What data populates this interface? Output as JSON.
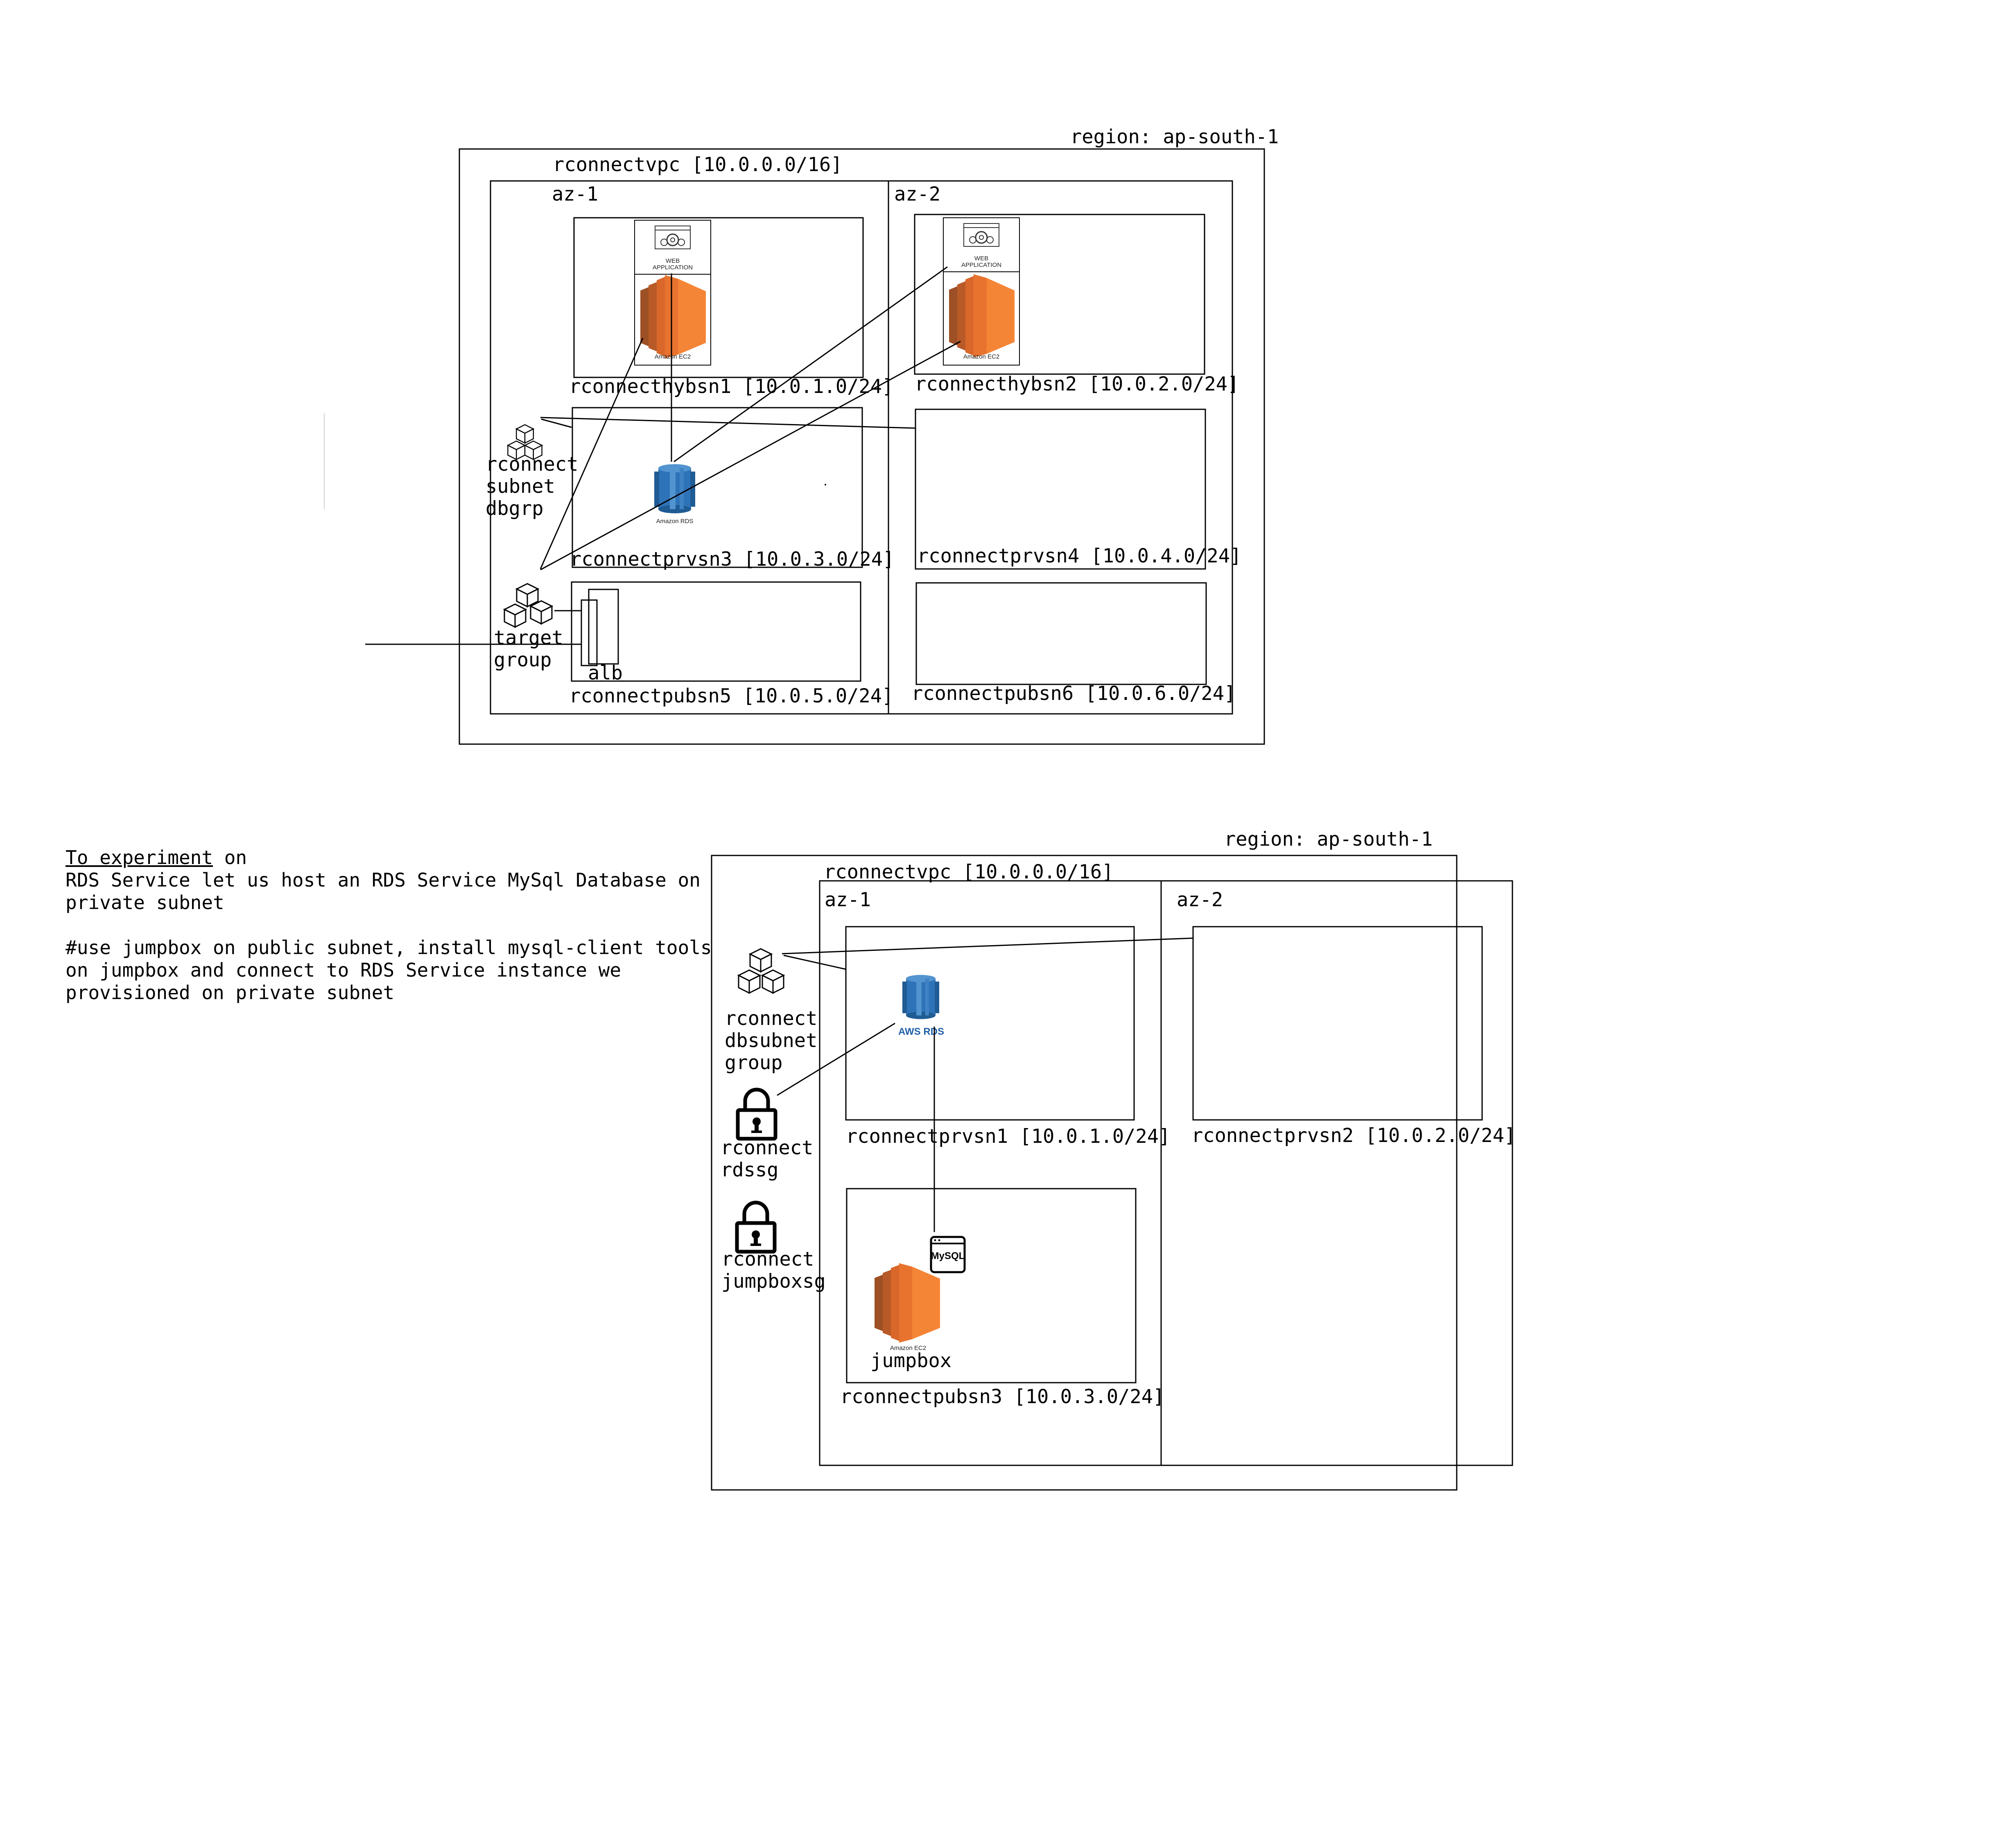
{
  "diagram1": {
    "region": "region: ap-south-1",
    "vpc": "rconnectvpc [10.0.0.0/16]",
    "az1": "az-1",
    "az2": "az-2",
    "subnets": {
      "hybsn1": "rconnecthybsn1 [10.0.1.0/24]",
      "hybsn2": "rconnecthybsn2 [10.0.2.0/24]",
      "prvsn3": "rconnectprvsn3 [10.0.3.0/24]",
      "prvsn4": "rconnectprvsn4 [10.0.4.0/24]",
      "pubsn5": "rconnectpubsn5 [10.0.5.0/24]",
      "pubsn6": "rconnectpubsn6 [10.0.6.0/24]"
    },
    "dbgrp": [
      "rconnect",
      "subnet",
      "dbgrp"
    ],
    "targetgroup": [
      "target",
      "group"
    ],
    "alb": "alb",
    "webapp_label": [
      "WEB",
      "APPLICATION"
    ],
    "ec2_label": "Amazon EC2",
    "rds_label": "Amazon RDS"
  },
  "note": {
    "line1_underlined": "To experiment",
    "line1_rest": " on",
    "line2": "RDS Service let us host an RDS Service MySql Database on",
    "line3": "private subnet",
    "line4": "#use jumpbox on public subnet, install mysql-client tools",
    "line5": "on jumpbox and connect to RDS Service instance we",
    "line6": "provisioned on private subnet"
  },
  "diagram2": {
    "region": "region: ap-south-1",
    "vpc": "rconnectvpc [10.0.0.0/16]",
    "az1": "az-1",
    "az2": "az-2",
    "subnets": {
      "prvsn1": "rconnectprvsn1 [10.0.1.0/24]",
      "prvsn2": "rconnectprvsn2 [10.0.2.0/24]",
      "pubsn3": "rconnectpubsn3 [10.0.3.0/24]"
    },
    "dbsubnetgroup": [
      "rconnect",
      "dbsubnet",
      "group"
    ],
    "rdssg": [
      "rconnect",
      "rdssg"
    ],
    "jumpboxsg": [
      "rconnect",
      "jumpboxsg"
    ],
    "aws_rds": "AWS RDS",
    "mysql": "MySQL",
    "ec2_label": "Amazon EC2",
    "jumpbox": "jumpbox"
  },
  "colors": {
    "ec2_orange": "#f58536",
    "ec2_dark": "#9d5025",
    "ec2_mid": "#d9672a",
    "rds_blue": "#2e73b8",
    "rds_dark": "#1f5b94",
    "rds_light": "#5294cf",
    "line": "#000000"
  }
}
